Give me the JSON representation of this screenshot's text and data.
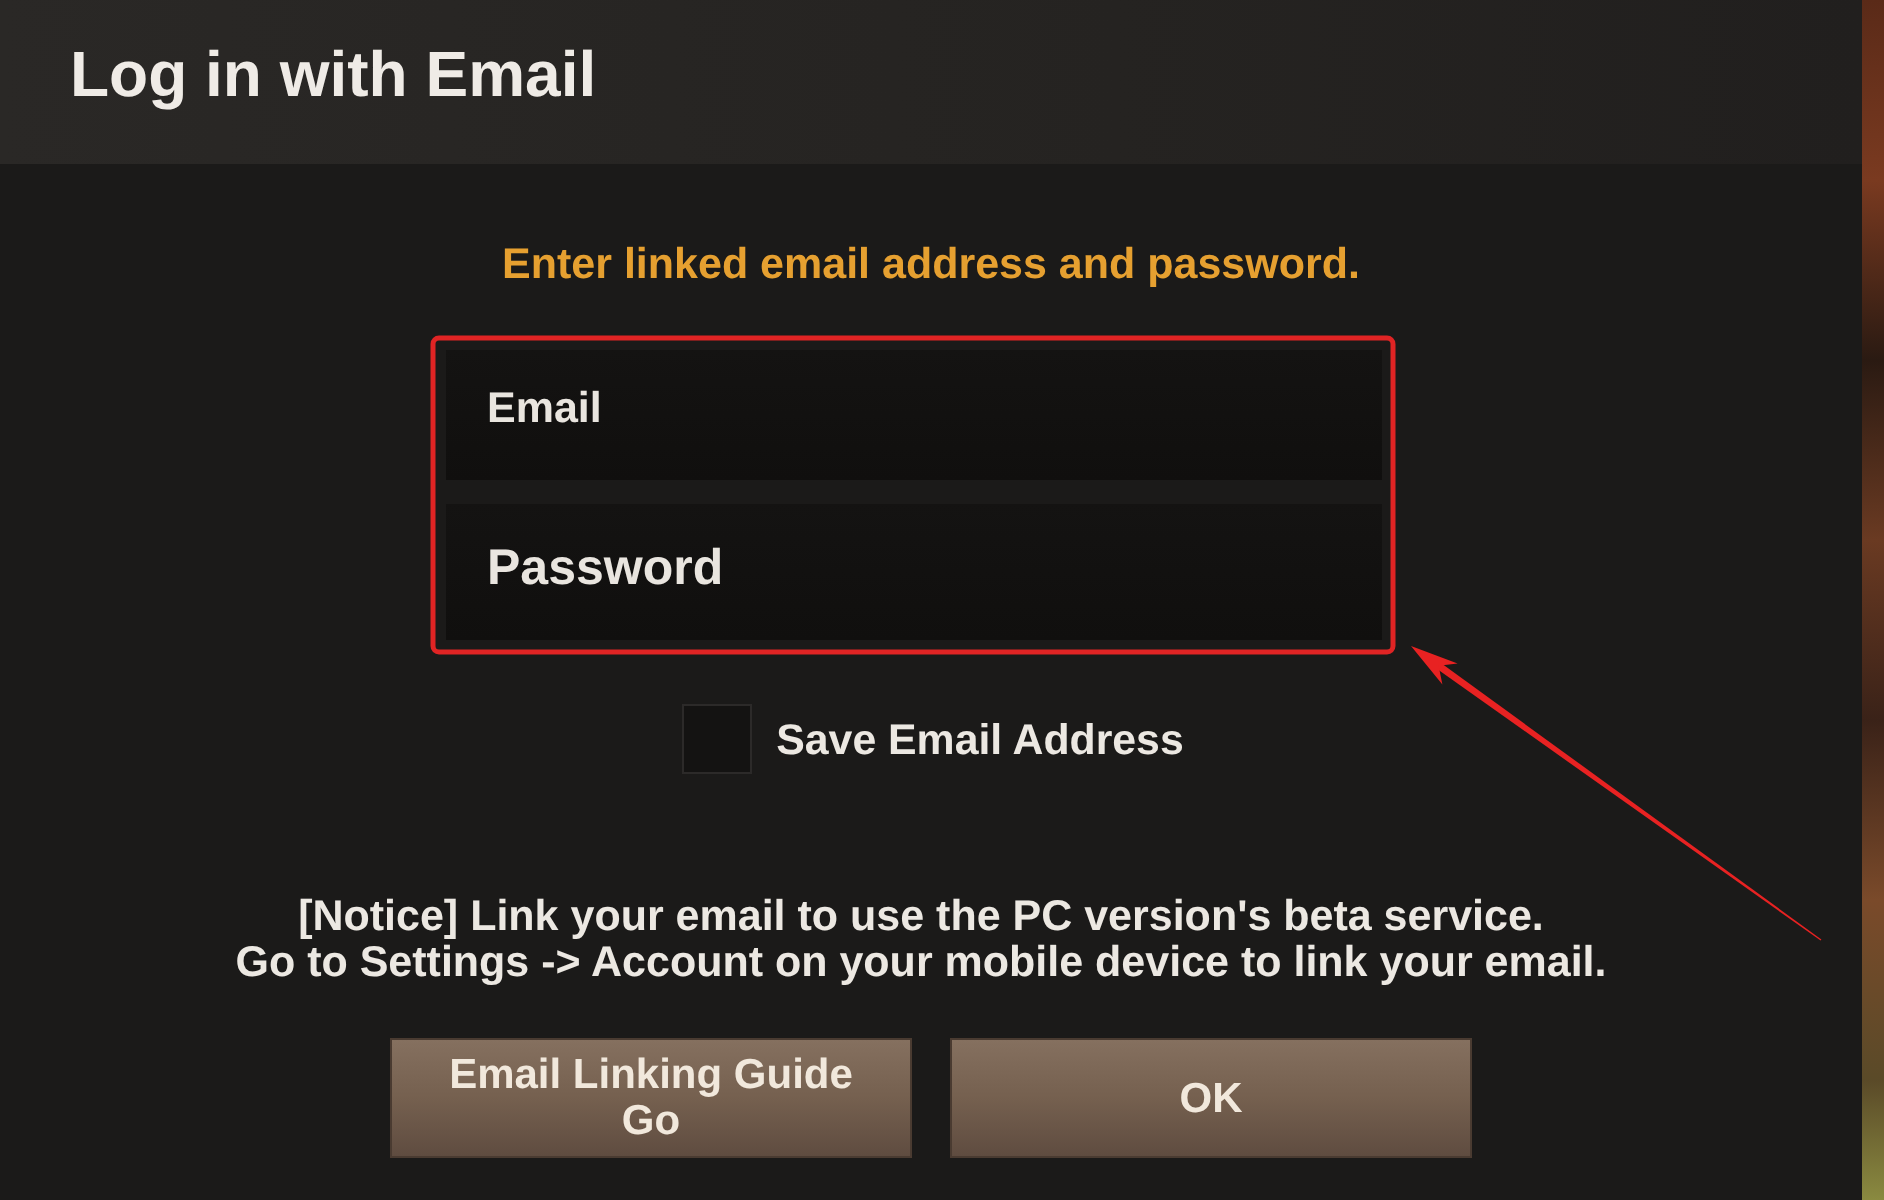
{
  "dialog": {
    "title": "Log in with Email"
  },
  "instruction": "Enter linked email address and password.",
  "fields": [
    {
      "kind": "email",
      "placeholder": "Email"
    },
    {
      "kind": "password",
      "placeholder": "Password"
    }
  ],
  "checkbox": {
    "label": "Save Email Address",
    "checked": false
  },
  "notice": [
    "[Notice] Link your email to use the PC version's beta service.",
    "Go to Settings -> Account on your mobile device to link your email."
  ],
  "buttons": [
    "Email Linking Guide\nGo",
    "OK"
  ],
  "annotation": {
    "kind": "arrow-box"
  }
}
